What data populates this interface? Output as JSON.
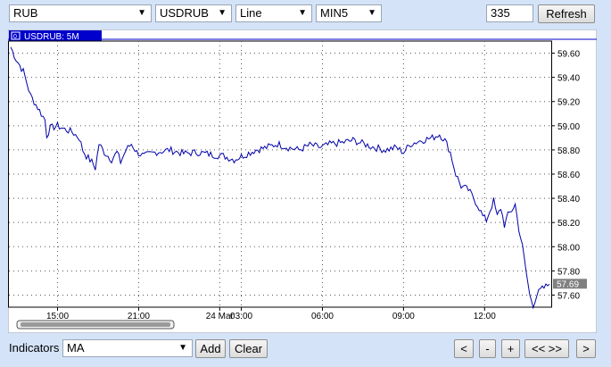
{
  "toolbar": {
    "currency": "RUB",
    "symbol": "USDRUB",
    "chart_type": "Line",
    "timeframe": "MIN5",
    "bars_count": "335",
    "refresh_label": "Refresh"
  },
  "footer": {
    "indicators_label": "Indicators",
    "indicator_value": "MA",
    "add_label": "Add",
    "clear_label": "Clear",
    "nav_prev": "<",
    "nav_minus": "-",
    "nav_plus": "+",
    "nav_fit": "<< >>",
    "nav_next": ">"
  },
  "colors": {
    "line": "#0000aa",
    "legend_bg": "#0000cc",
    "price_tag_bg": "#808080"
  },
  "chart_data": {
    "type": "line",
    "legend": "USDRUB: 5M",
    "current_price_label": "57.69",
    "y_ticks": [
      "59.60",
      "59.40",
      "59.20",
      "59.00",
      "58.80",
      "58.60",
      "58.40",
      "58.20",
      "58.00",
      "57.80",
      "57.60"
    ],
    "ylim": [
      57.5,
      59.7
    ],
    "x_ticks": [
      {
        "label": "15:00",
        "index": 26
      },
      {
        "label": "21:00",
        "index": 71
      },
      {
        "label": "24 Mar",
        "index": 116
      },
      {
        "label": "03:00",
        "index": 128
      },
      {
        "label": "06:00",
        "index": 173
      },
      {
        "label": "09:00",
        "index": 218
      },
      {
        "label": "12:00",
        "index": 263
      }
    ],
    "n_points": 300,
    "anchors": [
      [
        0,
        59.65
      ],
      [
        3,
        59.55
      ],
      [
        7,
        59.45
      ],
      [
        11,
        59.25
      ],
      [
        15,
        59.15
      ],
      [
        19,
        59.05
      ],
      [
        20,
        58.92
      ],
      [
        22,
        58.98
      ],
      [
        26,
        59.0
      ],
      [
        30,
        58.97
      ],
      [
        34,
        58.95
      ],
      [
        38,
        58.9
      ],
      [
        40,
        58.8
      ],
      [
        42,
        58.75
      ],
      [
        45,
        58.7
      ],
      [
        47,
        58.65
      ],
      [
        49,
        58.85
      ],
      [
        52,
        58.78
      ],
      [
        56,
        58.72
      ],
      [
        59,
        58.78
      ],
      [
        61,
        58.7
      ],
      [
        64,
        58.8
      ],
      [
        67,
        58.85
      ],
      [
        70,
        58.78
      ],
      [
        74,
        58.75
      ],
      [
        80,
        58.78
      ],
      [
        88,
        58.8
      ],
      [
        96,
        58.77
      ],
      [
        104,
        58.78
      ],
      [
        112,
        58.76
      ],
      [
        118,
        58.75
      ],
      [
        124,
        58.72
      ],
      [
        130,
        58.76
      ],
      [
        136,
        58.8
      ],
      [
        142,
        58.82
      ],
      [
        148,
        58.85
      ],
      [
        154,
        58.82
      ],
      [
        160,
        58.8
      ],
      [
        166,
        58.84
      ],
      [
        172,
        58.82
      ],
      [
        178,
        58.85
      ],
      [
        184,
        58.86
      ],
      [
        190,
        58.88
      ],
      [
        196,
        58.85
      ],
      [
        202,
        58.82
      ],
      [
        208,
        58.8
      ],
      [
        214,
        58.82
      ],
      [
        218,
        58.78
      ],
      [
        222,
        58.85
      ],
      [
        228,
        58.88
      ],
      [
        234,
        58.9
      ],
      [
        238,
        58.93
      ],
      [
        241,
        58.88
      ],
      [
        244,
        58.78
      ],
      [
        247,
        58.6
      ],
      [
        250,
        58.5
      ],
      [
        254,
        58.47
      ],
      [
        257,
        58.4
      ],
      [
        260,
        58.32
      ],
      [
        262,
        58.25
      ],
      [
        264,
        58.22
      ],
      [
        266,
        58.3
      ],
      [
        268,
        58.38
      ],
      [
        270,
        58.25
      ],
      [
        272,
        58.32
      ],
      [
        274,
        58.18
      ],
      [
        276,
        58.26
      ],
      [
        278,
        58.3
      ],
      [
        280,
        58.35
      ],
      [
        282,
        58.15
      ],
      [
        284,
        58.0
      ],
      [
        286,
        57.8
      ],
      [
        288,
        57.6
      ],
      [
        290,
        57.52
      ],
      [
        292,
        57.6
      ],
      [
        294,
        57.64
      ],
      [
        296,
        57.66
      ],
      [
        299,
        57.69
      ]
    ],
    "grid": true,
    "legend_position": "top-left"
  }
}
